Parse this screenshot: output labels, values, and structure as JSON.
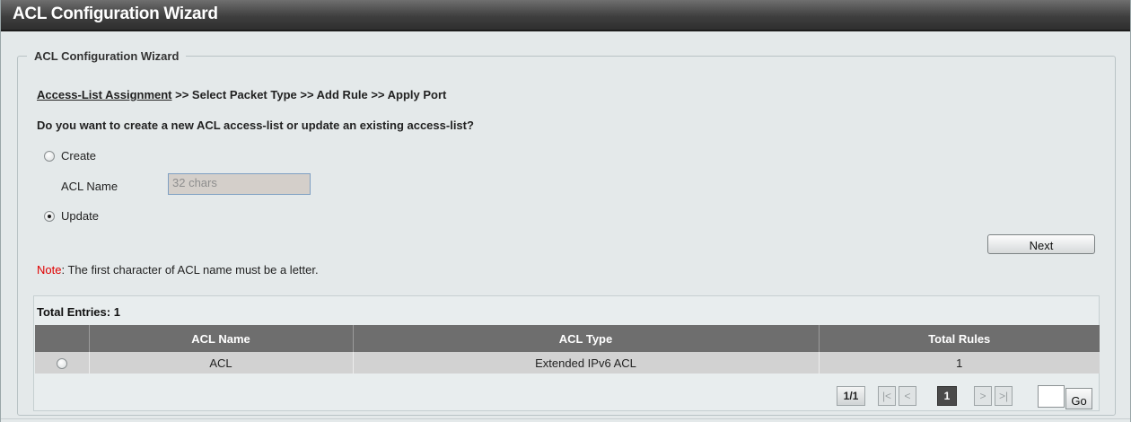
{
  "window": {
    "title": "ACL Configuration Wizard"
  },
  "wizard": {
    "legend": "ACL Configuration Wizard",
    "breadcrumb": {
      "current": "Access-List Assignment",
      "rest": " >> Select Packet Type >> Add Rule >> Apply Port"
    },
    "question": "Do you want to create a new ACL access-list or update an existing access-list?",
    "options": {
      "create_label": "Create",
      "update_label": "Update",
      "selected": "Update"
    },
    "acl_name": {
      "label": "ACL Name",
      "placeholder": "32 chars",
      "value": ""
    },
    "next_label": "Next",
    "note": {
      "key": "Note",
      "text": ":  The first character of ACL name must be a letter."
    }
  },
  "table": {
    "total_entries_label": "Total Entries: 1",
    "columns": [
      "",
      "ACL Name",
      "ACL Type",
      "Total Rules"
    ],
    "rows": [
      {
        "acl_name": "ACL",
        "acl_type": "Extended IPv6 ACL",
        "total_rules": "1"
      }
    ]
  },
  "pagination": {
    "page_indicator": "1/1",
    "first_label": "|<",
    "prev_label": "<",
    "current_page": "1",
    "next_label": ">",
    "last_label": ">|",
    "go_label": "Go",
    "go_value": ""
  },
  "colors": {
    "title_bar": "#3f3f3f",
    "panel_background": "#e4e9ea",
    "table_header": "#6e6e6e",
    "note_key": "#e00000"
  }
}
